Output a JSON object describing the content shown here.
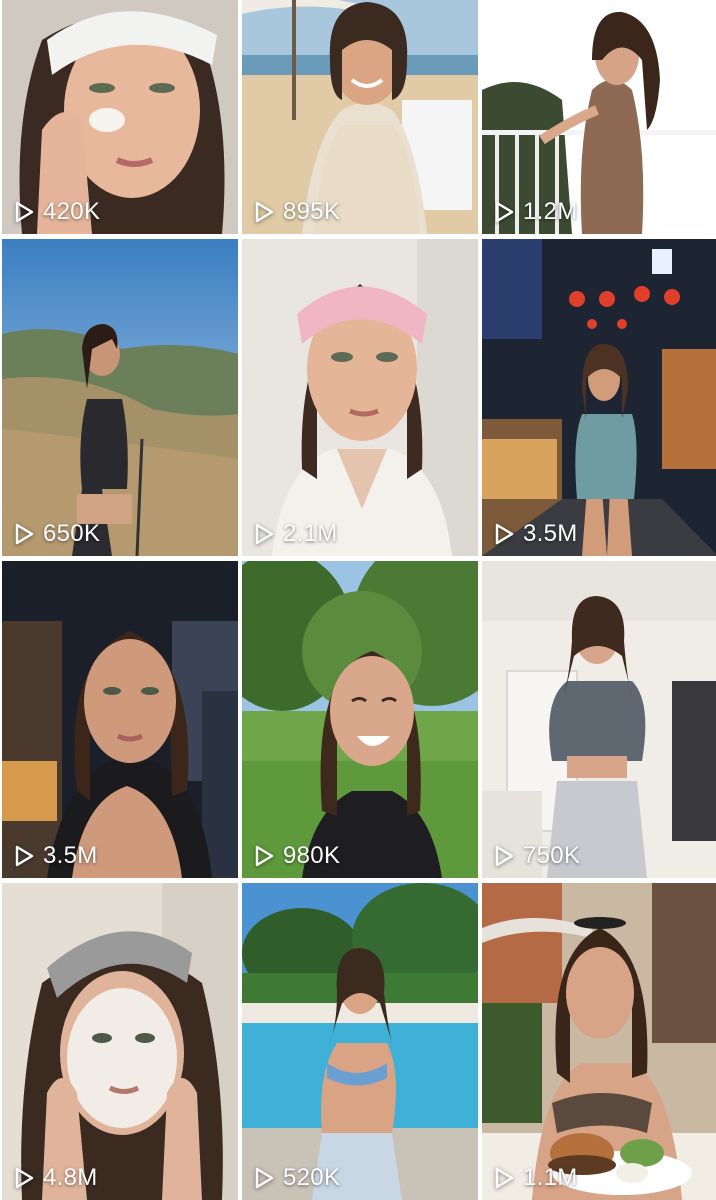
{
  "grid": {
    "tiles": [
      {
        "views": "420K",
        "scene": "skincare selfie with white headband"
      },
      {
        "views": "895K",
        "scene": "beach cafe"
      },
      {
        "views": "1.2M",
        "scene": "balcony pose"
      },
      {
        "views": "650K",
        "scene": "mountain hike"
      },
      {
        "views": "2.1M",
        "scene": "bathrobe selfie with pink headband"
      },
      {
        "views": "3.5M",
        "scene": "night market street"
      },
      {
        "views": "3.5M",
        "scene": "night market selfie"
      },
      {
        "views": "980K",
        "scene": "park laughing"
      },
      {
        "views": "750K",
        "scene": "bedroom outfit mirror"
      },
      {
        "views": "4.8M",
        "scene": "face mask selfie"
      },
      {
        "views": "520K",
        "scene": "pool side"
      },
      {
        "views": "1.1M",
        "scene": "cafe burger"
      }
    ],
    "icon": "play-icon"
  }
}
